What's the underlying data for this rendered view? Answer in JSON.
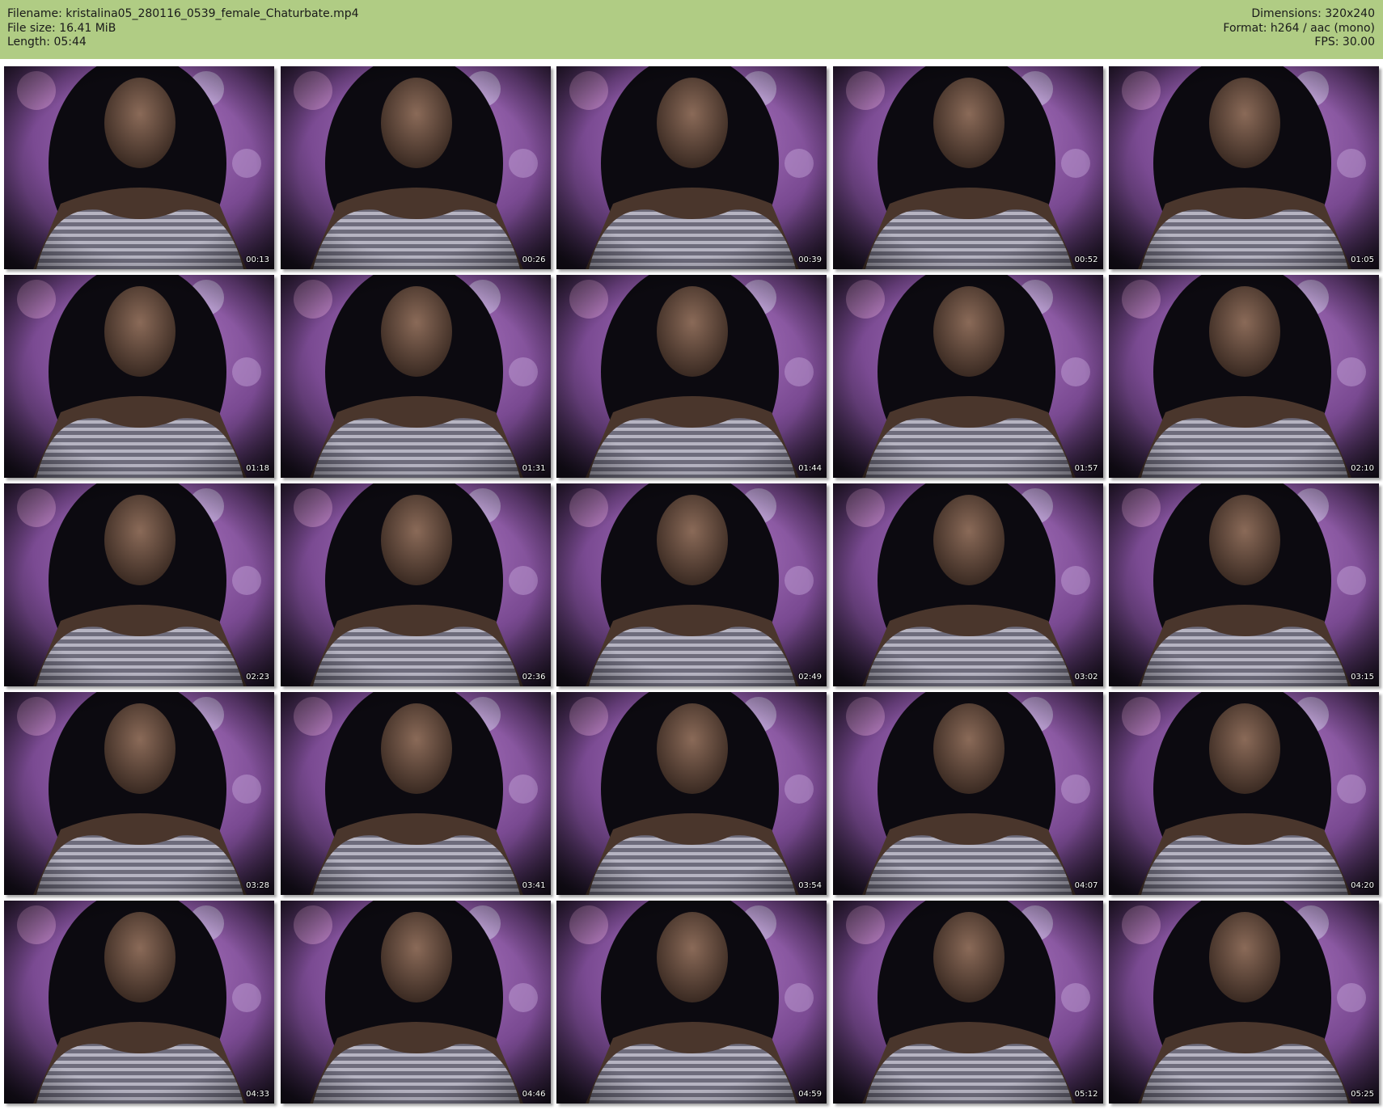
{
  "header": {
    "filename": "Filename: kristalina05_280116_0539_female_Chaturbate.mp4",
    "file_size": "File size: 16.41 MiB",
    "length": "Length: 05:44",
    "dimensions": "Dimensions: 320x240",
    "format": "Format: h264 / aac (mono)",
    "fps": "FPS: 30.00"
  },
  "colors": {
    "header_bg": "#b0cc84",
    "pillow_purple": "#a064b4",
    "shirt_gray": "#9a98a8"
  },
  "thumbnails": [
    {
      "time": "00:13"
    },
    {
      "time": "00:26"
    },
    {
      "time": "00:39"
    },
    {
      "time": "00:52"
    },
    {
      "time": "01:05"
    },
    {
      "time": "01:18"
    },
    {
      "time": "01:31"
    },
    {
      "time": "01:44"
    },
    {
      "time": "01:57"
    },
    {
      "time": "02:10"
    },
    {
      "time": "02:23"
    },
    {
      "time": "02:36"
    },
    {
      "time": "02:49"
    },
    {
      "time": "03:02"
    },
    {
      "time": "03:15"
    },
    {
      "time": "03:28"
    },
    {
      "time": "03:41"
    },
    {
      "time": "03:54"
    },
    {
      "time": "04:07"
    },
    {
      "time": "04:20"
    },
    {
      "time": "04:33"
    },
    {
      "time": "04:46"
    },
    {
      "time": "04:59"
    },
    {
      "time": "05:12"
    },
    {
      "time": "05:25"
    }
  ]
}
